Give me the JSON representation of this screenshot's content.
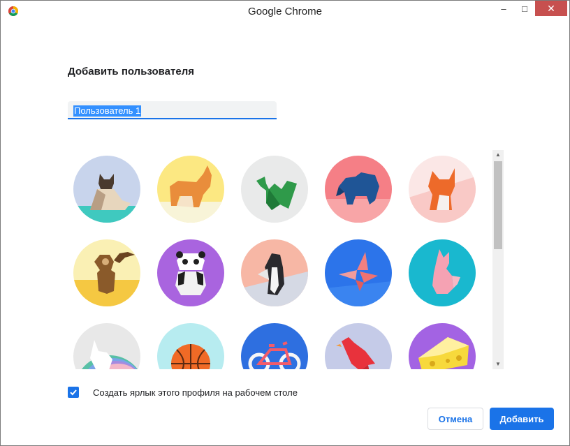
{
  "window": {
    "title": "Google Chrome",
    "controls": {
      "minimize": "–",
      "maximize": "□",
      "close": "✕"
    }
  },
  "dialog": {
    "heading": "Добавить пользователя",
    "name_value": "Пользователь 1",
    "avatars": [
      {
        "name": "cat"
      },
      {
        "name": "corgi"
      },
      {
        "name": "dragon"
      },
      {
        "name": "elephant"
      },
      {
        "name": "fox"
      },
      {
        "name": "monkey"
      },
      {
        "name": "panda"
      },
      {
        "name": "penguin"
      },
      {
        "name": "butterfly"
      },
      {
        "name": "rabbit"
      },
      {
        "name": "unicorn"
      },
      {
        "name": "basketball"
      },
      {
        "name": "bicycle"
      },
      {
        "name": "bird"
      },
      {
        "name": "cheese"
      }
    ],
    "checkbox_checked": true,
    "checkbox_label": "Создать ярлык этого профиля на рабочем столе",
    "cancel_label": "Отмена",
    "add_label": "Добавить"
  },
  "colors": {
    "accent": "#1a73e8",
    "close_button": "#c7504f"
  }
}
